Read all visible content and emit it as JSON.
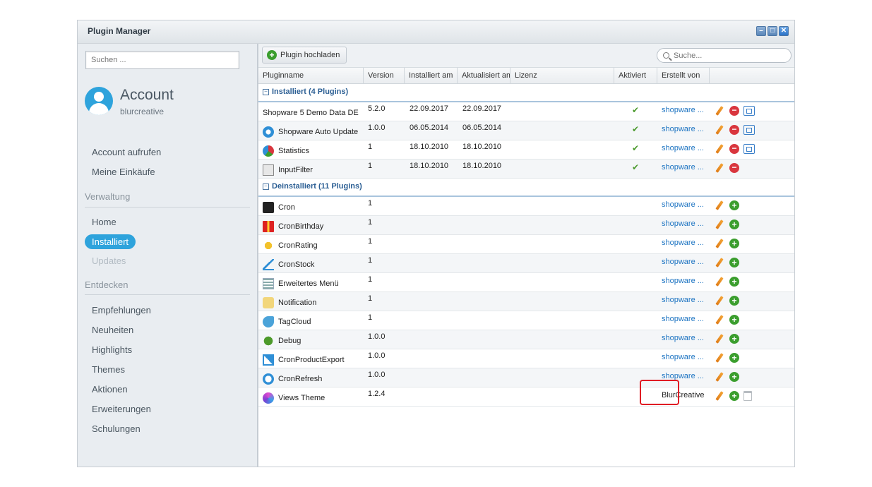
{
  "window": {
    "title": "Plugin Manager"
  },
  "sidebar": {
    "search_placeholder": "Suchen ...",
    "account_title": "Account",
    "account_user": "blurcreative",
    "account_items": [
      "Account aufrufen",
      "Meine Einkäufe"
    ],
    "section_verwaltung": "Verwaltung",
    "verwaltung_items": [
      "Home",
      "Installiert",
      "Updates"
    ],
    "section_entdecken": "Entdecken",
    "entdecken_items": [
      "Empfehlungen",
      "Neuheiten",
      "Highlights",
      "Themes",
      "Aktionen",
      "Erweiterungen",
      "Schulungen"
    ]
  },
  "toolbar": {
    "upload_label": "Plugin hochladen",
    "search_placeholder": "Suche..."
  },
  "columns": [
    "Pluginname",
    "Version",
    "Installiert am",
    "Aktualisiert am",
    "Lizenz",
    "Aktiviert",
    "Erstellt von"
  ],
  "groups": {
    "installed_label": "Installiert (4 Plugins)",
    "uninstalled_label": "Deinstalliert (11 Plugins)"
  },
  "installed": [
    {
      "name": "Shopware 5 Demo Data DE",
      "version": "5.2.0",
      "installed": "22.09.2017",
      "updated": "22.09.2017",
      "active": "✔",
      "author": "shopware ...",
      "icon": "none-icon"
    },
    {
      "name": "Shopware Auto Update",
      "version": "1.0.0",
      "installed": "06.05.2014",
      "updated": "06.05.2014",
      "active": "✔",
      "author": "shopware ...",
      "icon": "auto-update-icon"
    },
    {
      "name": "Statistics",
      "version": "1",
      "installed": "18.10.2010",
      "updated": "18.10.2010",
      "active": "✔",
      "author": "shopware ...",
      "icon": "pie-chart-icon"
    },
    {
      "name": "InputFilter",
      "version": "1",
      "installed": "18.10.2010",
      "updated": "18.10.2010",
      "active": "✔",
      "author": "shopware ...",
      "icon": "text-cursor-icon"
    }
  ],
  "uninstalled": [
    {
      "name": "Cron",
      "version": "1",
      "author": "shopware ...",
      "icon": "terminal-icon"
    },
    {
      "name": "CronBirthday",
      "version": "1",
      "author": "shopware ...",
      "icon": "gift-icon"
    },
    {
      "name": "CronRating",
      "version": "1",
      "author": "shopware ...",
      "icon": "star-icon"
    },
    {
      "name": "CronStock",
      "version": "1",
      "author": "shopware ...",
      "icon": "trend-chart-icon"
    },
    {
      "name": "Erweitertes Menü",
      "version": "1",
      "author": "shopware ...",
      "icon": "menu-icon"
    },
    {
      "name": "Notification",
      "version": "1",
      "author": "shopware ...",
      "icon": "speech-bubble-icon"
    },
    {
      "name": "TagCloud",
      "version": "1",
      "author": "shopware ...",
      "icon": "tag-icon"
    },
    {
      "name": "Debug",
      "version": "1.0.0",
      "author": "shopware ...",
      "icon": "bug-icon"
    },
    {
      "name": "CronProductExport",
      "version": "1.0.0",
      "author": "shopware ...",
      "icon": "export-icon"
    },
    {
      "name": "CronRefresh",
      "version": "1.0.0",
      "author": "shopware ...",
      "icon": "clock-refresh-icon"
    },
    {
      "name": "Views Theme",
      "version": "1.2.4",
      "author": "BlurCreative",
      "icon": "views-logo-icon"
    }
  ],
  "colors": {
    "accent": "#2ea3dc",
    "link": "#1d74c2",
    "install": "#3b9e2e",
    "uninstall": "#d9363e",
    "highlight": "#e01c24"
  }
}
